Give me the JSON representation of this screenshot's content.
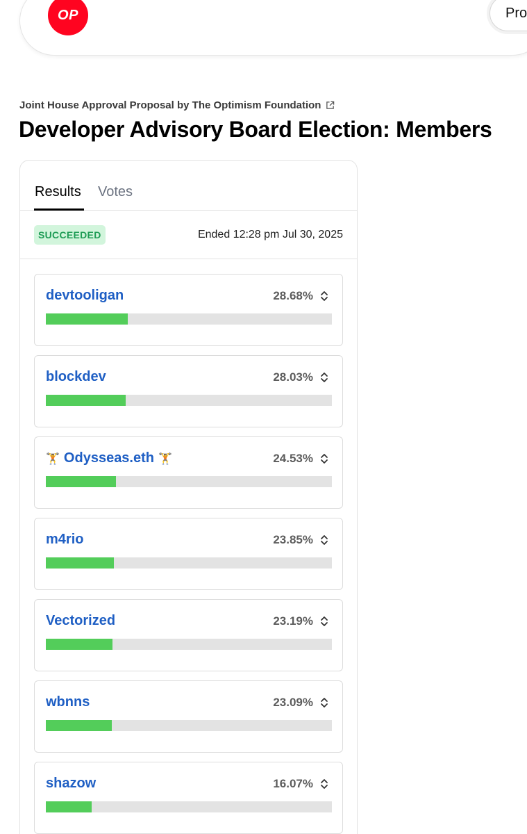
{
  "nav": {
    "logo_text": "OP",
    "button_label": "Propos"
  },
  "header": {
    "proposer_line": "Joint House Approval Proposal by The Optimism Foundation",
    "title": "Developer Advisory Board Election: Members"
  },
  "tabs": [
    {
      "label": "Results",
      "active": true
    },
    {
      "label": "Votes",
      "active": false
    }
  ],
  "status": {
    "badge": "SUCCEEDED",
    "ended": "Ended 12:28 pm Jul 30, 2025"
  },
  "candidates": [
    {
      "name": "devtooligan",
      "percent_label": "28.68%",
      "percent": 28.68
    },
    {
      "name": "blockdev",
      "percent_label": "28.03%",
      "percent": 28.03
    },
    {
      "name": "Odysseas.eth",
      "percent_label": "24.53%",
      "percent": 24.53,
      "icons": [
        "person-lifting-icon",
        "person-lifting-icon"
      ]
    },
    {
      "name": "m4rio",
      "percent_label": "23.85%",
      "percent": 23.85
    },
    {
      "name": "Vectorized",
      "percent_label": "23.19%",
      "percent": 23.19
    },
    {
      "name": "wbnns",
      "percent_label": "23.09%",
      "percent": 23.09
    },
    {
      "name": "shazow",
      "percent_label": "16.07%",
      "percent": 16.07
    }
  ],
  "colors": {
    "brand": "#ff0420",
    "candidate_name": "#1f5fc4",
    "bar_fill": "#53cd5a",
    "bar_track": "#e3e3e3",
    "badge_bg": "#d2f5dc",
    "badge_text": "#1e9c55"
  },
  "bar_scale_max_percent": 100
}
